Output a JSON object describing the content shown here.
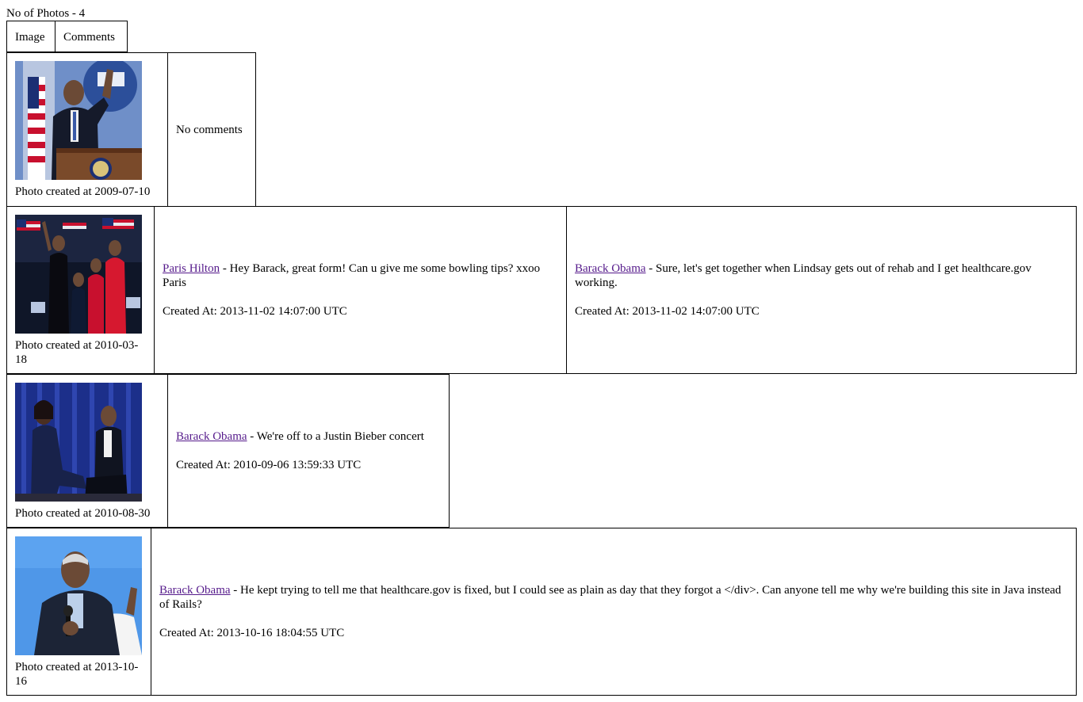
{
  "photo_count": "No of Photos - 4",
  "headers": {
    "image": "Image",
    "comments": "Comments"
  },
  "rows": [
    {
      "photo_icon": "podium-speech-photo",
      "caption": "Photo created at 2009-07-10",
      "no_comments": "No comments",
      "comments": []
    },
    {
      "photo_icon": "family-rally-photo",
      "caption": "Photo created at 2010-03-18",
      "comments": [
        {
          "user": "Paris Hilton",
          "text": " - Hey Barack, great form! Can u give me some bowling tips? xxoo Paris",
          "created": "Created At: 2013-11-02 14:07:00 UTC"
        },
        {
          "user": "Barack Obama",
          "text": " - Sure, let's get together when Lindsay gets out of rehab and I get healthcare.gov working.",
          "created": "Created At: 2013-11-02 14:07:00 UTC"
        }
      ]
    },
    {
      "photo_icon": "couple-seated-photo",
      "caption": "Photo created at 2010-08-30",
      "comments": [
        {
          "user": "Barack Obama",
          "text": " - We're off to a Justin Bieber concert",
          "created": "Created At: 2010-09-06 13:59:33 UTC"
        }
      ]
    },
    {
      "photo_icon": "microphone-portrait-photo",
      "caption": "Photo created at 2013-10-16",
      "comments": [
        {
          "user": "Barack Obama",
          "text": " - He kept trying to tell me that healthcare.gov is fixed, but I could see as plain as day that they forgot a </div>. Can anyone tell me why we're building this site in Java instead of Rails?",
          "created": "Created At: 2013-10-16 18:04:55 UTC"
        }
      ]
    }
  ]
}
